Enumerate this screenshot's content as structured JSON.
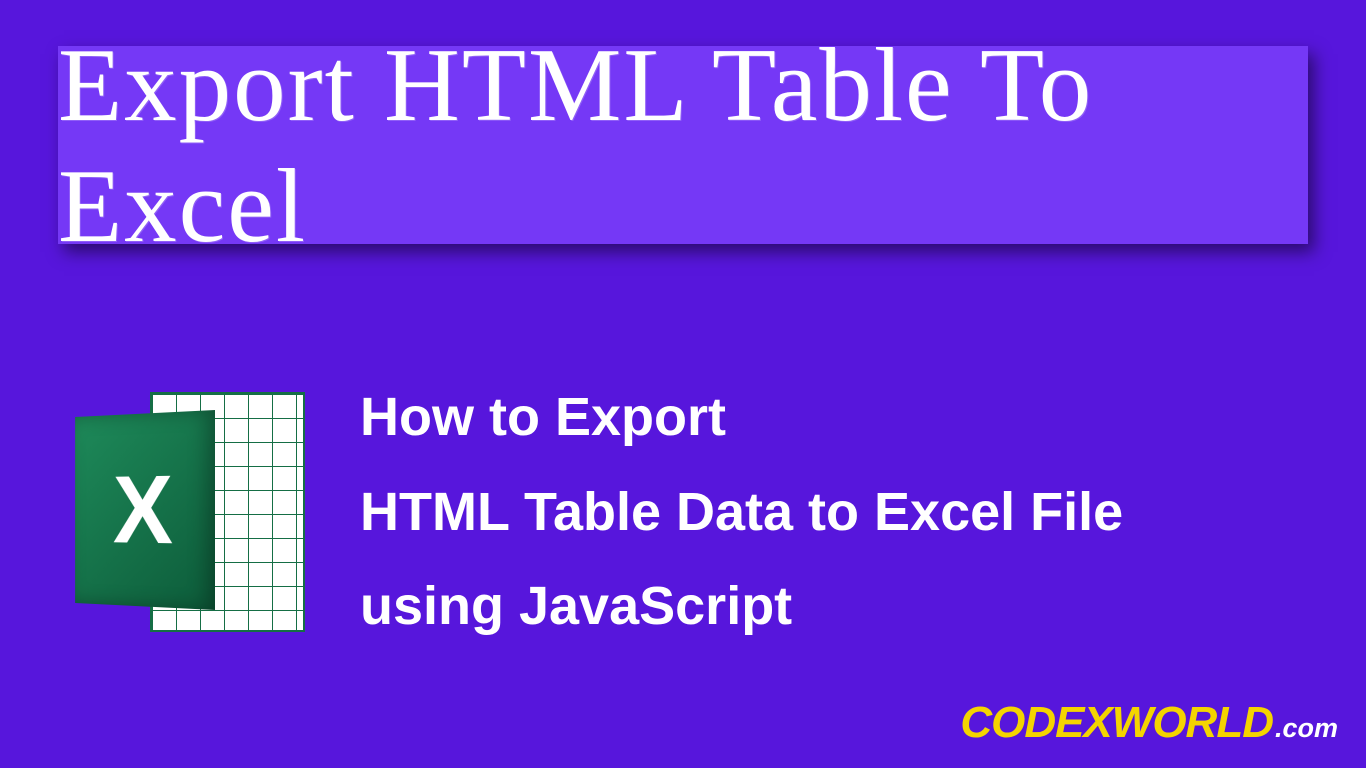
{
  "banner": {
    "title": "Export HTML Table To Excel"
  },
  "icon": {
    "letter": "X"
  },
  "subtitle": {
    "line1": "How to Export",
    "line2": "HTML Table Data to Excel File",
    "line3": "using JavaScript"
  },
  "brand": {
    "name": "CODEXWORLD",
    "ext": ".com"
  }
}
